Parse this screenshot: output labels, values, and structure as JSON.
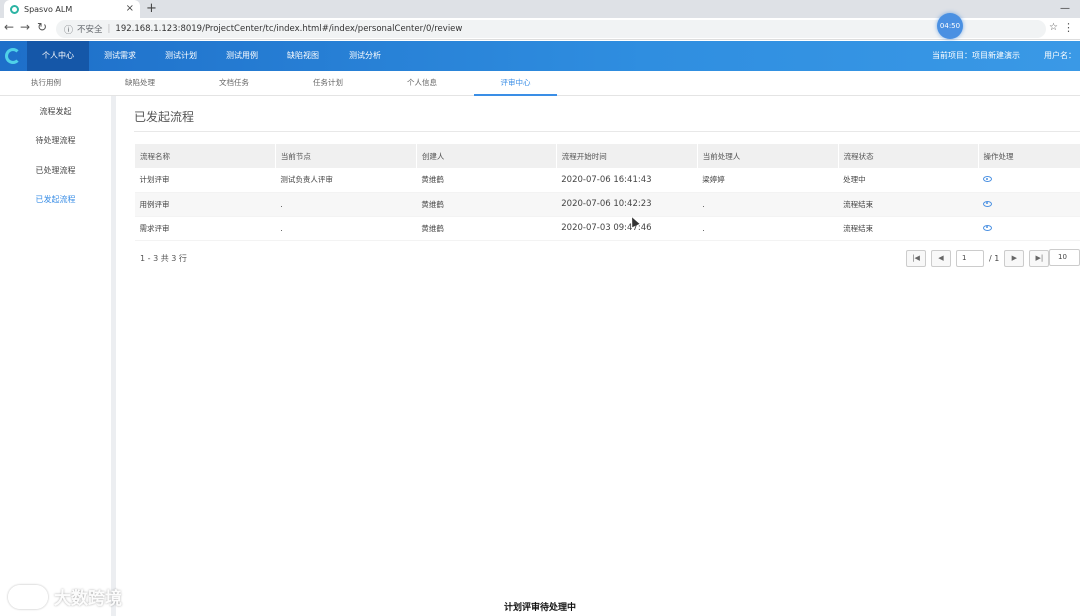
{
  "browser": {
    "tab_title": "Spasvo ALM",
    "tab_close": "×",
    "new_tab": "+",
    "security_label": "不安全",
    "url": "192.168.1.123:8019/ProjectCenter/tc/index.html#/index/personalCenter/0/review",
    "timer": "04:50"
  },
  "nav": {
    "items": [
      "个人中心",
      "测试需求",
      "测试计划",
      "测试用例",
      "缺陷视图",
      "测试分析"
    ],
    "project_label": "当前项目：项目新建演示",
    "user_label": "用户名："
  },
  "subtabs": [
    "执行用例",
    "缺陷处理",
    "文档任务",
    "任务计划",
    "个人信息",
    "评审中心"
  ],
  "sidebar": [
    "流程发起",
    "待处理流程",
    "已处理流程",
    "已发起流程"
  ],
  "page_title": "已发起流程",
  "table": {
    "headers": [
      "流程名称",
      "当前节点",
      "创建人",
      "流程开始时间",
      "当前处理人",
      "流程状态",
      "操作处理"
    ],
    "rows": [
      [
        "计划评审",
        "测试负责人评审",
        "黄维鹤",
        "2020-07-06 16:41:43",
        "梁婷婷",
        "处理中"
      ],
      [
        "用例评审",
        ".",
        "黄维鹤",
        "2020-07-06 10:42:23",
        ".",
        "流程结束"
      ],
      [
        "需求评审",
        ".",
        "黄维鹤",
        "2020-07-03 09:47:46",
        ".",
        "流程结束"
      ]
    ]
  },
  "pagination": {
    "summary": "1 - 3 共 3 行",
    "current_page": "1",
    "total": "/ 1",
    "page_size": "10"
  },
  "watermark": "大数跨境",
  "caption": "计划评审待处理中"
}
